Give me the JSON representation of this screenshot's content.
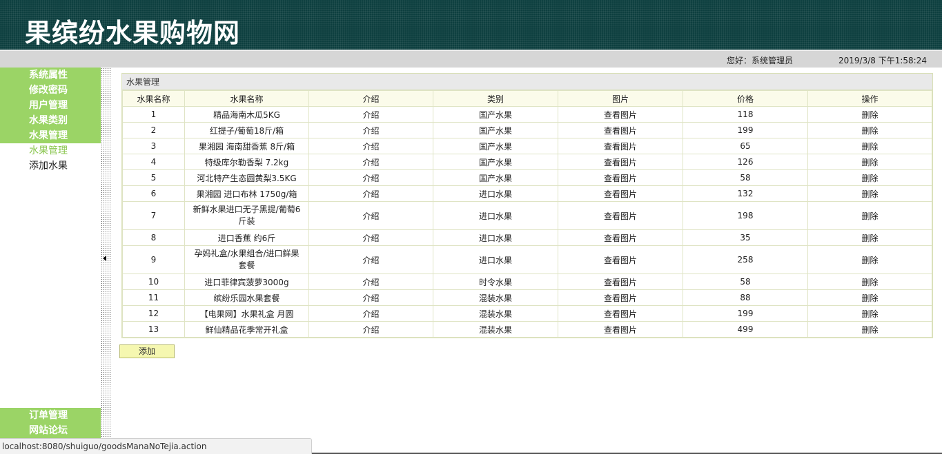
{
  "header": {
    "site_title": "果缤纷水果购物网"
  },
  "status": {
    "greeting": "您好：系统管理员",
    "datetime": "2019/3/8 下午1:58:24"
  },
  "sidebar": {
    "top_items": [
      "系统属性",
      "修改密码",
      "用户管理",
      "水果类别",
      "水果管理"
    ],
    "sub_items": [
      {
        "label": "水果管理",
        "active": true
      },
      {
        "label": "添加水果",
        "active": false
      }
    ],
    "bottom_items": [
      "订单管理",
      "网站论坛"
    ]
  },
  "panel": {
    "title": "水果管理",
    "columns": [
      "水果名称",
      "水果名称",
      "介绍",
      "类别",
      "图片",
      "价格",
      "操作"
    ],
    "rows": [
      {
        "no": "1",
        "name": "精品海南木瓜5KG",
        "intro": "介绍",
        "category": "国产水果",
        "image": "查看图片",
        "price": "118",
        "action": "删除"
      },
      {
        "no": "2",
        "name": "红提子/葡萄18斤/箱",
        "intro": "介绍",
        "category": "国产水果",
        "image": "查看图片",
        "price": "199",
        "action": "删除"
      },
      {
        "no": "3",
        "name": "果湘园 海南甜香蕉 8斤/箱",
        "intro": "介绍",
        "category": "国产水果",
        "image": "查看图片",
        "price": "65",
        "action": "删除"
      },
      {
        "no": "4",
        "name": "特级库尔勒香梨 7.2kg",
        "intro": "介绍",
        "category": "国产水果",
        "image": "查看图片",
        "price": "126",
        "action": "删除"
      },
      {
        "no": "5",
        "name": "河北特产生态圆黄梨3.5KG",
        "intro": "介绍",
        "category": "国产水果",
        "image": "查看图片",
        "price": "58",
        "action": "删除"
      },
      {
        "no": "6",
        "name": "果湘园 进口布林 1750g/箱",
        "intro": "介绍",
        "category": "进口水果",
        "image": "查看图片",
        "price": "132",
        "action": "删除"
      },
      {
        "no": "7",
        "name": "新鲜水果进口无子黑提/葡萄6斤装",
        "intro": "介绍",
        "category": "进口水果",
        "image": "查看图片",
        "price": "198",
        "action": "删除"
      },
      {
        "no": "8",
        "name": "进口香蕉 约6斤",
        "intro": "介绍",
        "category": "进口水果",
        "image": "查看图片",
        "price": "35",
        "action": "删除"
      },
      {
        "no": "9",
        "name": "孕妈礼盒/水果组合/进口鲜果套餐",
        "intro": "介绍",
        "category": "进口水果",
        "image": "查看图片",
        "price": "258",
        "action": "删除"
      },
      {
        "no": "10",
        "name": "进口菲律宾菠萝3000g",
        "intro": "介绍",
        "category": "时令水果",
        "image": "查看图片",
        "price": "58",
        "action": "删除"
      },
      {
        "no": "11",
        "name": "缤纷乐园水果套餐",
        "intro": "介绍",
        "category": "混装水果",
        "image": "查看图片",
        "price": "88",
        "action": "删除"
      },
      {
        "no": "12",
        "name": "【电果网】水果礼盒 月圆",
        "intro": "介绍",
        "category": "混装水果",
        "image": "查看图片",
        "price": "199",
        "action": "删除"
      },
      {
        "no": "13",
        "name": "鲜仙精品花季常开礼盒",
        "intro": "介绍",
        "category": "混装水果",
        "image": "查看图片",
        "price": "499",
        "action": "删除"
      }
    ],
    "add_label": "添加"
  },
  "browser": {
    "status_url": "localhost:8080/shuiguo/goodsManaNoTejia.action"
  }
}
